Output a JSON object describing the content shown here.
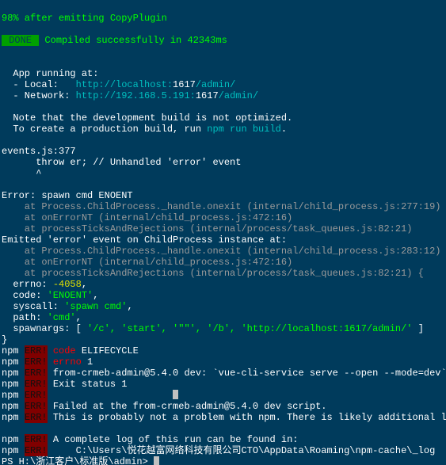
{
  "header": {
    "progress": "98% after emitting CopyPlugin"
  },
  "compile": {
    "done": " DONE ",
    "msg": "Compiled successfully in 42343ms"
  },
  "app": {
    "running": "  App running at:",
    "local_lbl": "  - Local:   ",
    "local_url1": "http://localhost:",
    "local_port": "1617",
    "local_url2": "/admin/",
    "net_lbl": "  - Network: ",
    "net_url1": "http://192.168.5.191:",
    "net_port": "1617",
    "net_url2": "/admin/",
    "note1": "  Note that the development build is not optimized.",
    "note2a": "  To create a production build, run ",
    "note2b": "npm run build",
    "note2c": "."
  },
  "events": {
    "file": "events.js:377",
    "throw": "      throw er; // Unhandled 'error' event",
    "caret": "      ^"
  },
  "err": {
    "title": "Error: spawn cmd ENOENT",
    "at1": "    at Process.ChildProcess._handle.onexit (internal/child_process.js:277:19)",
    "at2": "    at onErrorNT (internal/child_process.js:472:16)",
    "at3": "    at processTicksAndRejections (internal/process/task_queues.js:82:21)"
  },
  "emit": {
    "title": "Emitted 'error' event on ChildProcess instance at:",
    "at1": "    at Process.ChildProcess._handle.onexit (internal/child_process.js:283:12)",
    "at2": "    at onErrorNT (internal/child_process.js:472:16)",
    "at3": "    at processTicksAndRejections (internal/process/task_queues.js:82:21) {"
  },
  "obj": {
    "errno": "  errno: ",
    "errno_v": "-4058",
    "errno_e": ",",
    "code": "  code: ",
    "code_v": "'ENOENT'",
    "code_e": ",",
    "syscall": "  syscall: ",
    "syscall_v": "'spawn cmd'",
    "syscall_e": ",",
    "path": "  path: ",
    "path_v": "'cmd'",
    "path_e": ",",
    "spawn": "  spawnargs: [ ",
    "spawn_v": "'/c', 'start', '\"\"', '/b', 'http://localhost:1617/admin/'",
    "spawn_e": " ]",
    "close": "}"
  },
  "npm": {
    "tag": "npm",
    "err": "ERR!",
    "sp": " ",
    "code": " code",
    "code_v": " ELIFECYCLE",
    "errno": " errno",
    "errno_v": " 1",
    "l3": " from-crmeb-admin@5.4.0 dev: `vue-cli-service serve --open --mode=dev`",
    "l4": " Exit status 1",
    "l5": "",
    "l6": " Failed at the from-crmeb-admin@5.4.0 dev script.",
    "l7": " This is probably not a problem with npm. There is likely additional log",
    "l9": " A complete log of this run can be found in:",
    "l10": "     C:\\Users\\悦花越富网络科技有限公司CTO\\AppData\\Roaming\\npm-cache\\_log"
  },
  "prompt": {
    "text": "PS H:\\浙江客户\\标准版\\admin> "
  }
}
